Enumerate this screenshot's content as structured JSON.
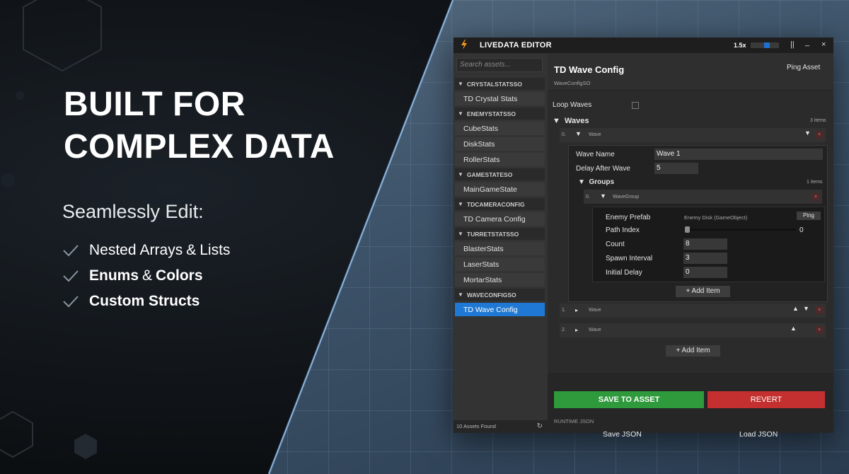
{
  "marketing": {
    "headline_line1": "BUILT FOR",
    "headline_line2": "COMPLEX DATA",
    "subheading": "Seamlessly Edit:",
    "features": [
      {
        "bold1": "",
        "pre": "Nested",
        "bold_a": "Arrays",
        "joiner": "&",
        "bold_b": "Lists"
      },
      {
        "bold_a": "Enums",
        "joiner": "&",
        "bold_b": "Colors"
      },
      {
        "bold_a": "Custom Structs"
      }
    ]
  },
  "window": {
    "title": "LIVEDATA EDITOR",
    "zoom": "1.5x",
    "pause_label": "||",
    "minimize_label": "_",
    "close_label": "×",
    "accent_color": "#1f79d4"
  },
  "sidebar": {
    "search_placeholder": "Search assets...",
    "categories": [
      {
        "name": "CRYSTALSTATSSO",
        "items": [
          "TD Crystal Stats"
        ]
      },
      {
        "name": "ENEMYSTATSSO",
        "items": [
          "CubeStats",
          "DiskStats",
          "RollerStats"
        ]
      },
      {
        "name": "GAMESTATESO",
        "items": [
          "MainGameState"
        ]
      },
      {
        "name": "TDCAMERACONFIG",
        "items": [
          "TD Camera Config"
        ]
      },
      {
        "name": "TURRETSTATSSO",
        "items": [
          "BlasterStats",
          "LaserStats",
          "MortarStats"
        ]
      },
      {
        "name": "WAVECONFIGSO",
        "items": [
          "TD Wave Config"
        ]
      }
    ],
    "selected_item": "TD Wave Config",
    "footer": "10 Assets Found"
  },
  "editor": {
    "asset_title": "TD Wave Config",
    "asset_type": "WaveConfigSO",
    "ping_asset_label": "Ping Asset",
    "loop_waves_label": "Loop Waves",
    "waves_label": "Waves",
    "waves_count": "3 items",
    "wave0": {
      "index": "0.",
      "type": "Wave",
      "wave_name_label": "Wave Name",
      "wave_name_value": "Wave 1",
      "delay_label": "Delay After Wave",
      "delay_value": "5",
      "groups_label": "Groups",
      "groups_count": "1 items",
      "group0": {
        "index": "0.",
        "type": "WaveGroup",
        "enemy_prefab_label": "Enemy Prefab",
        "enemy_prefab_value": "Enemy Disk (GameObject)",
        "ping_label": "Ping",
        "path_index_label": "Path Index",
        "path_index_value": "0",
        "path_index_slider": 0,
        "count_label": "Count",
        "count_value": "8",
        "spawn_interval_label": "Spawn Interval",
        "spawn_interval_value": "3",
        "initial_delay_label": "Initial Delay",
        "initial_delay_value": "0"
      },
      "add_item_label": "+ Add Item"
    },
    "wave1": {
      "index": "1.",
      "type": "Wave"
    },
    "wave2": {
      "index": "2.",
      "type": "Wave"
    },
    "add_item_label": "+ Add Item",
    "delete_label": "×",
    "save_label": "SAVE TO ASSET",
    "revert_label": "REVERT",
    "runtime_json_label": "RUNTIME JSON",
    "save_json_label": "Save JSON",
    "load_json_label": "Load JSON",
    "save_color": "#2e9a3b",
    "revert_color": "#c3302f"
  }
}
